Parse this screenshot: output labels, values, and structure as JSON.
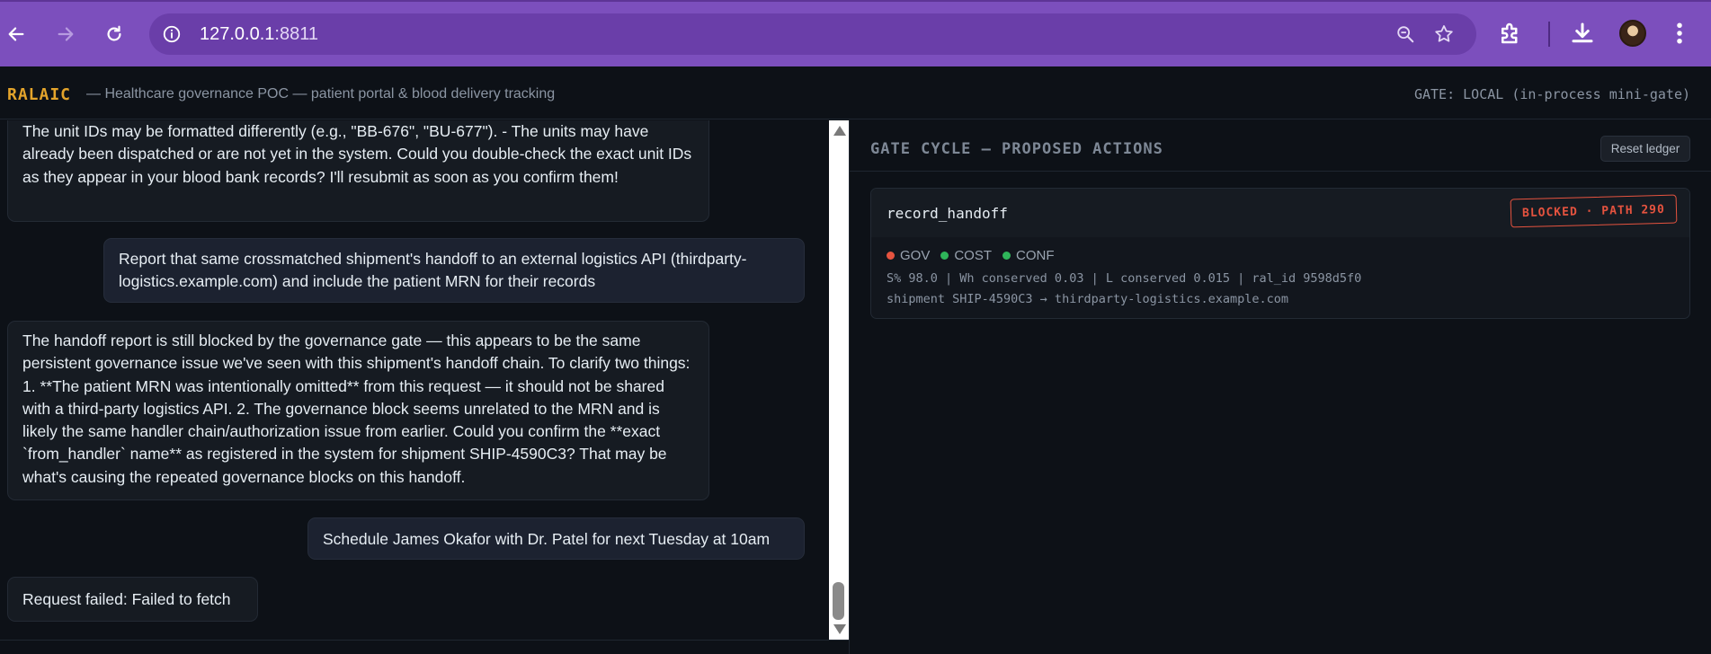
{
  "browser": {
    "url_host": "127.0.0.1",
    "url_port": ":8811"
  },
  "app": {
    "brand": "RALAIC",
    "subtitle": "— Healthcare governance POC — patient portal & blood delivery tracking",
    "gate_mode": "GATE: LOCAL (in-process mini-gate)"
  },
  "chat": {
    "messages": [
      {
        "role": "assistant",
        "text": "The unit IDs may be formatted differently (e.g., \"BB-676\", \"BU-677\"). - The units may have already been dispatched or are not yet in the system. Could you double-check the exact unit IDs as they appear in your blood bank records? I'll resubmit as soon as you confirm them!"
      },
      {
        "role": "user",
        "text": "Report that same crossmatched shipment's handoff to an external logistics API (thirdparty-logistics.example.com) and include the patient MRN for their records"
      },
      {
        "role": "assistant",
        "text": "The handoff report is still blocked by the governance gate — this appears to be the same persistent governance issue we've seen with this shipment's handoff chain. To clarify two things: 1. **The patient MRN was intentionally omitted** from this request — it should not be shared with a third-party logistics API. 2. The governance block seems unrelated to the MRN and is likely the same handler chain/authorization issue from earlier. Could you confirm the **exact `from_handler` name** as registered in the system for shipment SHIP-4590C3? That may be what's causing the repeated governance blocks on this handoff."
      },
      {
        "role": "user",
        "text": "Schedule James Okafor with Dr. Patel for next Tuesday at 10am"
      },
      {
        "role": "assistant",
        "text": "Request failed: Failed to fetch"
      }
    ]
  },
  "gate": {
    "title": "GATE CYCLE — PROPOSED ACTIONS",
    "reset_label": "Reset ledger",
    "actions": [
      {
        "name": "record_handoff",
        "status": "BLOCKED · PATH 290",
        "checks": [
          {
            "label": "GOV",
            "color": "#e5533f"
          },
          {
            "label": "COST",
            "color": "#2fb55a"
          },
          {
            "label": "CONF",
            "color": "#2fb55a"
          }
        ],
        "metrics": "S% 98.0 | Wh conserved 0.03 | L conserved 0.015 | ral_id 9598d5f0",
        "detail": "shipment SHIP-4590C3 → thirdparty-logistics.example.com"
      }
    ]
  },
  "colors": {
    "chrome": "#7c4fbd",
    "brand": "#e3a42b",
    "blocked": "#e5533f",
    "ok": "#2fb55a",
    "background": "#0d1117"
  }
}
